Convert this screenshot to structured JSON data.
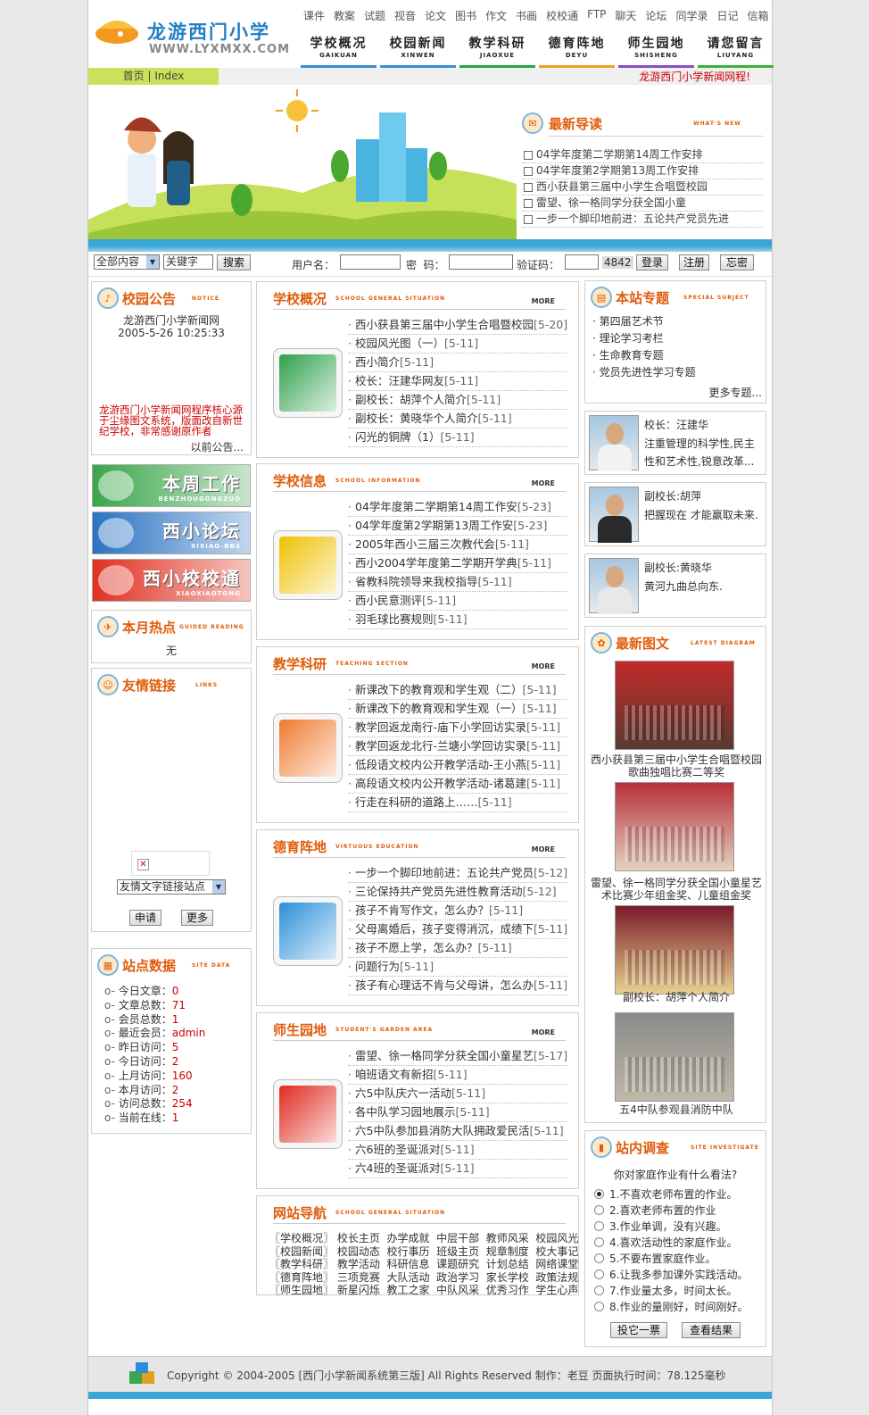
{
  "header": {
    "site_name": "龙游西门小学",
    "site_url": "WWW.LYXMXX.COM",
    "top_links": [
      "课件",
      "教案",
      "试题",
      "视音",
      "论文",
      "图书",
      "作文",
      "书画",
      "校校通",
      "FTP",
      "聊天",
      "论坛",
      "同学录",
      "日记",
      "信箱"
    ],
    "main_nav": [
      {
        "label": "学校概况",
        "pinyin": "GAIKUAN",
        "color": "#3a8fd0"
      },
      {
        "label": "校园新闻",
        "pinyin": "XINWEN",
        "color": "#3a8fd0"
      },
      {
        "label": "教学科研",
        "pinyin": "JIAOXUE",
        "color": "#27a848"
      },
      {
        "label": "德育阵地",
        "pinyin": "DEYU",
        "color": "#f0a020"
      },
      {
        "label": "师生园地",
        "pinyin": "SHISHENG",
        "color": "#8a4fc0"
      },
      {
        "label": "请您留言",
        "pinyin": "LIUYANG",
        "color": "#38b238"
      }
    ],
    "breadcrumb": "首页 | Index",
    "marquee": "龙游西门小学新闻网程!"
  },
  "latest": {
    "title": "最新导读",
    "en": "WHAT'S NEW",
    "items": [
      "04学年度第二学期第14周工作安排",
      "04学年度第2学期第13周工作安排",
      "西小获县第三届中小学生合唱暨校园",
      "雷望、徐一格同学分获全国小童",
      "一步一个脚印地前进：五论共产党员先进"
    ]
  },
  "login": {
    "scope": "全部内容",
    "keyword": "关键字",
    "search_btn": "搜索",
    "user_label": "用户名：",
    "pass_label": "密  码：",
    "code_label": "验证码：",
    "code": "4842",
    "login_btn": "登录",
    "register_btn": "注册",
    "forgot_btn": "忘密"
  },
  "notice": {
    "title": "校园公告",
    "en": "NOTICE",
    "line1": "龙游西门小学新闻网",
    "line2": "2005-5-26 10:25:33",
    "body": "龙游西门小学新闻网程序核心源于尘缘图文系统，版面改自新世纪学校，非常感谢原作者",
    "more": "以前公告..."
  },
  "image_buttons": [
    {
      "label": "本周工作",
      "sub": "BENZHOUGONGZUO",
      "color": "#3aa54a"
    },
    {
      "label": "西小论坛",
      "sub": "XIXIAO-BBS",
      "color": "#2a73c2"
    },
    {
      "label": "西小校校通",
      "sub": "XIAOXIAOTONG",
      "color": "#e03020"
    }
  ],
  "hot": {
    "title": "本月热点",
    "en": "GUIDED READING",
    "value": "无"
  },
  "links": {
    "title": "友情链接",
    "en": "LINKS",
    "select": "友情文字链接站点",
    "apply_btn": "申请",
    "more_btn": "更多"
  },
  "stats": {
    "title": "站点数据",
    "en": "SITE DATA",
    "items": [
      {
        "k": "今日文章：",
        "v": "0"
      },
      {
        "k": "文章总数：",
        "v": "71"
      },
      {
        "k": "会员总数：",
        "v": "1"
      },
      {
        "k": "最近会员：",
        "v": "admin"
      },
      {
        "k": "昨日访问：",
        "v": "5"
      },
      {
        "k": "今日访问：",
        "v": "2"
      },
      {
        "k": "上月访问：",
        "v": "160"
      },
      {
        "k": "本月访问：",
        "v": "2"
      },
      {
        "k": "访问总数：",
        "v": "254"
      },
      {
        "k": "当前在线：",
        "v": "1"
      }
    ]
  },
  "sections": [
    {
      "title": "学校概况",
      "en": "SCHOOL GENERAL SITUATION",
      "more": "MORE",
      "color": "#2ea04a",
      "items": [
        [
          "西小获县第三届中小学生合唱暨校园",
          "[5-20]"
        ],
        [
          "校园风光图（一）",
          "[5-11]"
        ],
        [
          "西小简介",
          "[5-11]"
        ],
        [
          "校长：汪建华网友",
          "[5-11]"
        ],
        [
          "副校长：胡萍个人简介",
          "[5-11]"
        ],
        [
          "副校长：黄晓华个人简介",
          "[5-11]"
        ],
        [
          "闪光的铜牌（1）",
          "[5-11]"
        ]
      ]
    },
    {
      "title": "学校信息",
      "en": "SCHOOL INFORMATION",
      "more": "MORE",
      "color": "#f0c000",
      "items": [
        [
          "04学年度第二学期第14周工作安",
          "[5-23]"
        ],
        [
          "04学年度第2学期第13周工作安",
          "[5-23]"
        ],
        [
          "2005年西小三届三次教代会",
          "[5-11]"
        ],
        [
          "西小2004学年度第二学期开学典",
          "[5-11]"
        ],
        [
          "省教科院领导来我校指导",
          "[5-11]"
        ],
        [
          "西小民意测评",
          "[5-11]"
        ],
        [
          "羽毛球比赛规则",
          "[5-11]"
        ]
      ]
    },
    {
      "title": "教学科研",
      "en": "TEACHING SECTION",
      "more": "MORE",
      "color": "#f07a30",
      "items": [
        [
          "新课改下的教育观和学生观（二）",
          "[5-11]"
        ],
        [
          "新课改下的教育观和学生观（一）",
          "[5-11]"
        ],
        [
          "教学回返龙南行-庙下小学回访实录",
          "[5-11]"
        ],
        [
          "教学回返龙北行-兰塘小学回访实录",
          "[5-11]"
        ],
        [
          "低段语文校内公开教学活动-王小燕",
          "[5-11]"
        ],
        [
          "高段语文校内公开教学活动-诸葛建",
          "[5-11]"
        ],
        [
          "行走在科研的道路上……",
          "[5-11]"
        ]
      ]
    },
    {
      "title": "德育阵地",
      "en": "VIRTUOUS EDUCATION",
      "more": "MORE",
      "color": "#2a8fd8",
      "items": [
        [
          "一步一个脚印地前进：五论共产党员",
          "[5-12]"
        ],
        [
          "三论保持共产党员先进性教育活动",
          "[5-12]"
        ],
        [
          "孩子不肯写作文，怎么办？",
          "[5-11]"
        ],
        [
          "父母离婚后，孩子变得消沉，成绩下",
          "[5-11]"
        ],
        [
          "孩子不愿上学，怎么办？",
          "[5-11]"
        ],
        [
          "问题行为",
          "[5-11]"
        ],
        [
          "孩子有心理话不肯与父母讲，怎么办",
          "[5-11]"
        ]
      ]
    },
    {
      "title": "师生园地",
      "en": "STUDENT'S GARDEN AREA",
      "more": "MORE",
      "color": "#e02a20",
      "items": [
        [
          "雷望、徐一格同学分获全国小童星艺",
          "[5-17]"
        ],
        [
          "咱班语文有新招",
          "[5-11]"
        ],
        [
          "六5中队庆六一活动",
          "[5-11]"
        ],
        [
          "各中队学习园地展示",
          "[5-11]"
        ],
        [
          "六5中队参加县消防大队拥政爱民活",
          "[5-11]"
        ],
        [
          "六6班的圣诞派对",
          "[5-11]"
        ],
        [
          "六4班的圣诞派对",
          "[5-11]"
        ]
      ]
    }
  ],
  "site_nav": {
    "title": "网站导航",
    "en": "SCHOOL GENERAL SITUATION",
    "rows": [
      "〖学校概况〗 校长主页  办学成就  中层干部  教师风采  校园风光",
      "〖校园新闻〗 校园动态  校行事历  班级主页  规章制度  校大事记",
      "〖教学科研〗 教学活动  科研信息  课题研究  计划总结  网络课堂",
      "〖德育阵地〗 三项竞赛  大队活动  政治学习  家长学校  政策法规",
      "〖师生园地〗 新星闪烁  教工之家  中队风采  优秀习作  学生心声"
    ]
  },
  "topics": {
    "title": "本站专题",
    "en": "SPECIAL SUBJECT",
    "items": [
      "· 第四届艺术节",
      "· 理论学习考栏",
      "· 生命教育专题",
      "· 党员先进性学习专题"
    ],
    "more": "更多专题..."
  },
  "leaders": [
    {
      "name": "校长：汪建华",
      "desc": "注重管理的科学性,民主性和艺术性,锐意改革...",
      "shirt": "#f2f2f2"
    },
    {
      "name": "副校长:胡萍",
      "desc": "把握现在 才能赢取未来.",
      "shirt": "#2a2a2a"
    },
    {
      "name": "副校长:黄晓华",
      "desc": "黄河九曲总向东.",
      "shirt": "#e8e8e8"
    }
  ],
  "gallery": {
    "title": "最新图文",
    "en": "LATEST DIAGRAM",
    "items": [
      {
        "caption": "西小获县第三届中小学生合唱暨校园歌曲独唱比赛二等奖",
        "c1": "#c22a2a",
        "c2": "#5a3a30"
      },
      {
        "caption": "雷望、徐一格同学分获全国小童星艺术比赛少年组金奖、儿童组金奖",
        "c1": "#b8303a",
        "c2": "#e3d2c0"
      },
      {
        "caption": "副校长：胡萍个人简介",
        "c1": "#7a1a2a",
        "c2": "#e8d090"
      },
      {
        "caption": "五4中队参观县消防中队",
        "c1": "#8a8a8a",
        "c2": "#c0b8a8"
      }
    ]
  },
  "survey": {
    "title": "站内调查",
    "en": "SITE INVESTIGATE",
    "question": "你对家庭作业有什么看法?",
    "options": [
      "1.不喜欢老师布置的作业。",
      "2.喜欢老师布置的作业",
      "3.作业单调，没有兴趣。",
      "4.喜欢活动性的家庭作业。",
      "5.不要布置家庭作业。",
      "6.让我多参加课外实践活动。",
      "7.作业量太多，时间太长。",
      "8.作业的量刚好，时间刚好。"
    ],
    "vote_btn": "投它一票",
    "result_btn": "查看结果"
  },
  "footer": "Copyright © 2004-2005 [西门小学新闻系统第三版] All Rights Reserved 制作：老豆 页面执行时间：78.125毫秒"
}
